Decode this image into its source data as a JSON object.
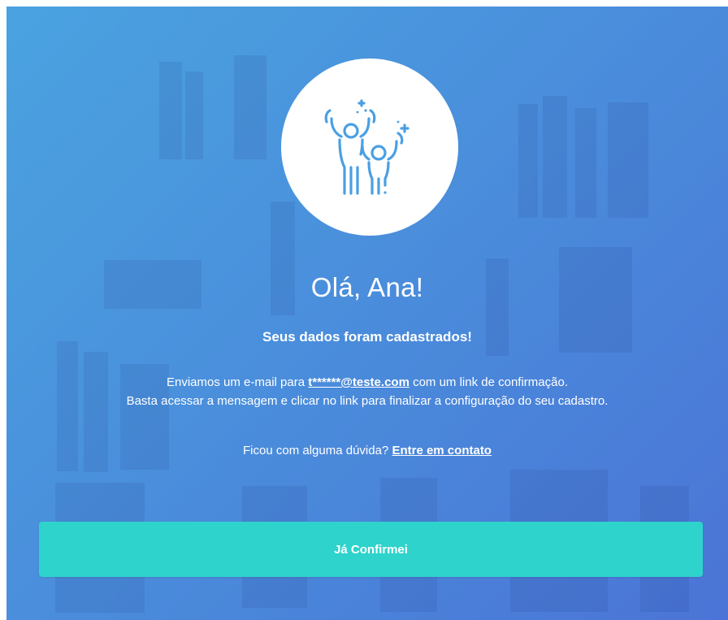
{
  "hero": {
    "icon": "celebrating-parent-child-icon",
    "icon_color": "#4a9fe3"
  },
  "greeting": "Olá, Ana!",
  "subtitle": "Seus dados foram cadastrados!",
  "message": {
    "line1_prefix": "Enviamos um e-mail para ",
    "email": "t******@teste.com",
    "line1_suffix": " com um link de confirmação.",
    "line2": "Basta acessar a mensagem e clicar no link para finalizar a configuração do seu cadastro."
  },
  "help": {
    "prefix": "Ficou com alguma dúvida? ",
    "link": "Entre em contato"
  },
  "button": {
    "label": "Já Confirmei",
    "color": "#2ed3cb"
  },
  "colors": {
    "background_start": "#4aa3e0",
    "background_end": "#4b74d6"
  }
}
